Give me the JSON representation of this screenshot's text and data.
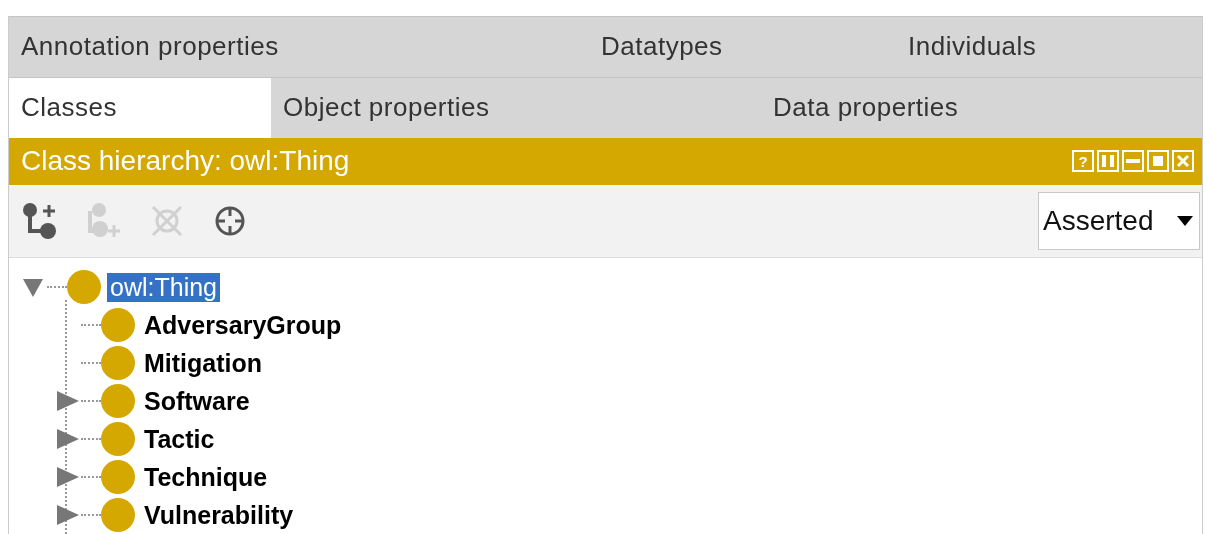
{
  "tab_rows": [
    [
      {
        "label": "Annotation properties",
        "selected": false
      },
      {
        "label": "Datatypes",
        "selected": false
      },
      {
        "label": "Individuals",
        "selected": false
      }
    ],
    [
      {
        "label": "Classes",
        "selected": true
      },
      {
        "label": "Object properties",
        "selected": false
      },
      {
        "label": "Data properties",
        "selected": false
      }
    ]
  ],
  "view": {
    "title": "Class hierarchy: owl:Thing",
    "header_buttons": [
      {
        "kind": "help",
        "glyph": "?"
      },
      {
        "kind": "split-vertical"
      },
      {
        "kind": "split-horizontal"
      },
      {
        "kind": "maximize"
      },
      {
        "kind": "close"
      }
    ]
  },
  "toolbar": [
    {
      "kind": "add-subclass",
      "disabled": false
    },
    {
      "kind": "add-sibling",
      "disabled": true
    },
    {
      "kind": "delete",
      "disabled": true
    },
    {
      "kind": "target",
      "disabled": false
    }
  ],
  "mode_dropdown": {
    "value": "Asserted"
  },
  "tree": [
    {
      "label": "owl:Thing",
      "selected": true,
      "bold": false,
      "expanded": true,
      "children": [
        {
          "label": "AdversaryGroup",
          "selected": false,
          "bold": true
        },
        {
          "label": "Mitigation",
          "selected": false,
          "bold": true
        },
        {
          "label": "Software",
          "selected": false,
          "bold": true,
          "expanded": false
        },
        {
          "label": "Tactic",
          "selected": false,
          "bold": true,
          "expanded": false
        },
        {
          "label": "Technique",
          "selected": false,
          "bold": true,
          "expanded": false
        },
        {
          "label": "Vulnerability",
          "selected": false,
          "bold": true,
          "expanded": false
        }
      ]
    }
  ]
}
